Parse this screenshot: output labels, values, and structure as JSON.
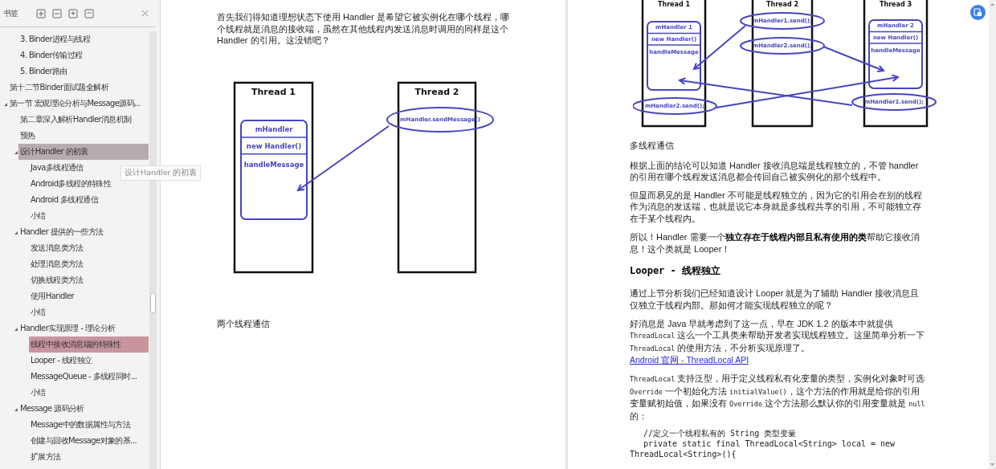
{
  "sidebar": {
    "title": "书签",
    "tooltip": "设计Handler 的初衷",
    "items": [
      {
        "children": [
          {
            "label": "3. Binder进程与线程",
            "selected": false,
            "hovered": false
          },
          {
            "label": "4. Binder传输过程",
            "selected": false,
            "hovered": false
          },
          {
            "label": "5. Binder路由",
            "selected": false,
            "hovered": false
          }
        ]
      },
      {
        "label": "第十二节Binder面试题全解析",
        "selected": false,
        "hovered": false
      },
      {
        "label": "第一节 宏观理论分析与Message源码...",
        "expanded": true,
        "selected": false,
        "hovered": false,
        "children": [
          {
            "label": "第二章深入解析Handler消息机制",
            "selected": false,
            "hovered": false
          },
          {
            "label": "预热",
            "selected": false,
            "hovered": false
          },
          {
            "label": "设计Handler 的初衷",
            "expanded": true,
            "selected": false,
            "hovered": true,
            "children": [
              {
                "label": "Java多线程通信",
                "selected": false,
                "hovered": false
              },
              {
                "label": "Android多线程的特殊性",
                "selected": false,
                "hovered": false
              },
              {
                "label": "Android 多线程通信",
                "selected": false,
                "hovered": false
              },
              {
                "label": "小结",
                "selected": false,
                "hovered": false
              }
            ]
          },
          {
            "label": "Handler 提供的一些方法",
            "expanded": true,
            "selected": false,
            "hovered": false,
            "children": [
              {
                "label": "发送消息类方法",
                "selected": false,
                "hovered": false
              },
              {
                "label": "处理消息类方法",
                "selected": false,
                "hovered": false
              },
              {
                "label": "切换线程类方法",
                "selected": false,
                "hovered": false
              },
              {
                "label": "使用Handler",
                "selected": false,
                "hovered": false
              },
              {
                "label": "小结",
                "selected": false,
                "hovered": false
              }
            ]
          },
          {
            "label": "Handler实现原理 - 理论分析",
            "expanded": true,
            "selected": false,
            "hovered": false,
            "children": [
              {
                "label": "线程中接收消息端的特殊性",
                "selected": true,
                "hovered": false
              },
              {
                "label": "Looper - 线程独立",
                "selected": false,
                "hovered": false
              },
              {
                "label": "MessageQueue - 多线程同时...",
                "selected": false,
                "hovered": false
              },
              {
                "label": "小结",
                "selected": false,
                "hovered": false
              }
            ]
          },
          {
            "label": "Message 源码分析",
            "expanded": true,
            "selected": false,
            "hovered": false,
            "children": [
              {
                "label": "Message中的数据属性与方法",
                "selected": false,
                "hovered": false
              },
              {
                "label": "创建与回收Message对象的基...",
                "selected": false,
                "hovered": false
              },
              {
                "label": "扩展方法",
                "selected": false,
                "hovered": false
              }
            ]
          }
        ]
      }
    ]
  },
  "pages": [
    {
      "blocks": [
        {
          "kind": "paragraph",
          "runs": [
            {
              "kind": "text",
              "text": "首先我们得知道理想状态下使用 Handler 是希望它被实例化在哪个线程，哪个线程就是消息的接收端，虽然在其他线程内发送消息时调用的同样是这个 Handler 的引用。这没错吧？"
            }
          ]
        },
        {
          "kind": "diagram",
          "threads": [
            {
              "title": "Thread 1",
              "handler": [
                "mHandler",
                "new Handler()",
                "handleMessage"
              ]
            },
            {
              "title": "Thread 2",
              "calls": [
                "mHandler.sendMessage()"
              ]
            }
          ]
        },
        {
          "kind": "caption",
          "text": "两个线程通信"
        }
      ]
    },
    {
      "blocks": [
        {
          "kind": "diagram",
          "threads": [
            {
              "title": "Thread 1",
              "handler": [
                "mHandler 1",
                "new Handler()",
                "handleMessage"
              ],
              "calls": [
                "mHandler2.send();"
              ]
            },
            {
              "title": "Thread 2",
              "calls": [
                "mHandler1.send();",
                "mHandler2.send();"
              ]
            },
            {
              "title": "Thread  3",
              "handler": [
                "mHandler 2",
                "new Handler()",
                "handleMessage"
              ],
              "calls": [
                "mHandler1.send();"
              ]
            }
          ]
        },
        {
          "kind": "caption",
          "text": "多线程通信"
        },
        {
          "kind": "paragraph",
          "runs": [
            {
              "kind": "text",
              "text": "根据上面的结论可以知道 Handler 接收消息端是线程独立的，不管 handler 的引用在哪个线程发送消息都会传回自己被实例化的那个线程中。"
            }
          ]
        },
        {
          "kind": "paragraph",
          "runs": [
            {
              "kind": "text",
              "text": "但显而易见的是 Handler 不可能是线程独立的，因为它的引用会在别的线程作为消息的发送端，也就是说它本身就是多线程共享的引用，不可能独立存在于某个线程内。"
            }
          ]
        },
        {
          "kind": "paragraph",
          "runs": [
            {
              "kind": "text",
              "text": "所以！Handler 需要一个"
            },
            {
              "kind": "bold",
              "text": "独立存在于线程内部且私有使用的类"
            },
            {
              "kind": "text",
              "text": "帮助它接收消息！这个类就是 Looper！"
            }
          ]
        },
        {
          "kind": "heading",
          "text": "Looper - 线程独立"
        },
        {
          "kind": "paragraph",
          "runs": [
            {
              "kind": "text",
              "text": "通过上节分析我们已经知道设计 Looper 就是为了辅助 Handler 接收消息且仅独立于线程内部。那如何才能实现线程独立的呢？"
            }
          ]
        },
        {
          "kind": "paragraph",
          "runs": [
            {
              "kind": "text",
              "text": "好消息是 Java 早就考虑到了这一点，早在 JDK 1.2 的版本中就提供 "
            },
            {
              "kind": "code",
              "text": "ThreadLocal"
            },
            {
              "kind": "text",
              "text": " 这么一个工具类来帮助开发者实现线程独立。这里简单分析一下 "
            },
            {
              "kind": "code",
              "text": "ThreadLocal"
            },
            {
              "kind": "text",
              "text": " 的使用方法，不分析实现原理了。"
            },
            {
              "kind": "link",
              "text": "Android 官网 - ThreadLocal API"
            }
          ]
        },
        {
          "kind": "paragraph",
          "runs": [
            {
              "kind": "code",
              "text": "ThreadLocal"
            },
            {
              "kind": "text",
              "text": " 支持泛型，用于定义线程私有化变量的类型，实例化对象时可选 "
            },
            {
              "kind": "code",
              "text": "Override"
            },
            {
              "kind": "text",
              "text": " 一个初始化方法 "
            },
            {
              "kind": "code",
              "text": "initialValue()"
            },
            {
              "kind": "text",
              "text": "，这个方法的作用就是给你的引用变量赋初始值，如果没有 "
            },
            {
              "kind": "code",
              "text": "Override"
            },
            {
              "kind": "text",
              "text": " 这个方法那么默认你的引用变量就是 "
            },
            {
              "kind": "code",
              "text": "null"
            },
            {
              "kind": "text",
              "text": " 的："
            }
          ]
        },
        {
          "kind": "code",
          "lines": [
            "//定义一个线程私有的 String 类型变量",
            "private static final ThreadLocal<String> local = new ThreadLocal<String>(){"
          ]
        }
      ]
    }
  ]
}
